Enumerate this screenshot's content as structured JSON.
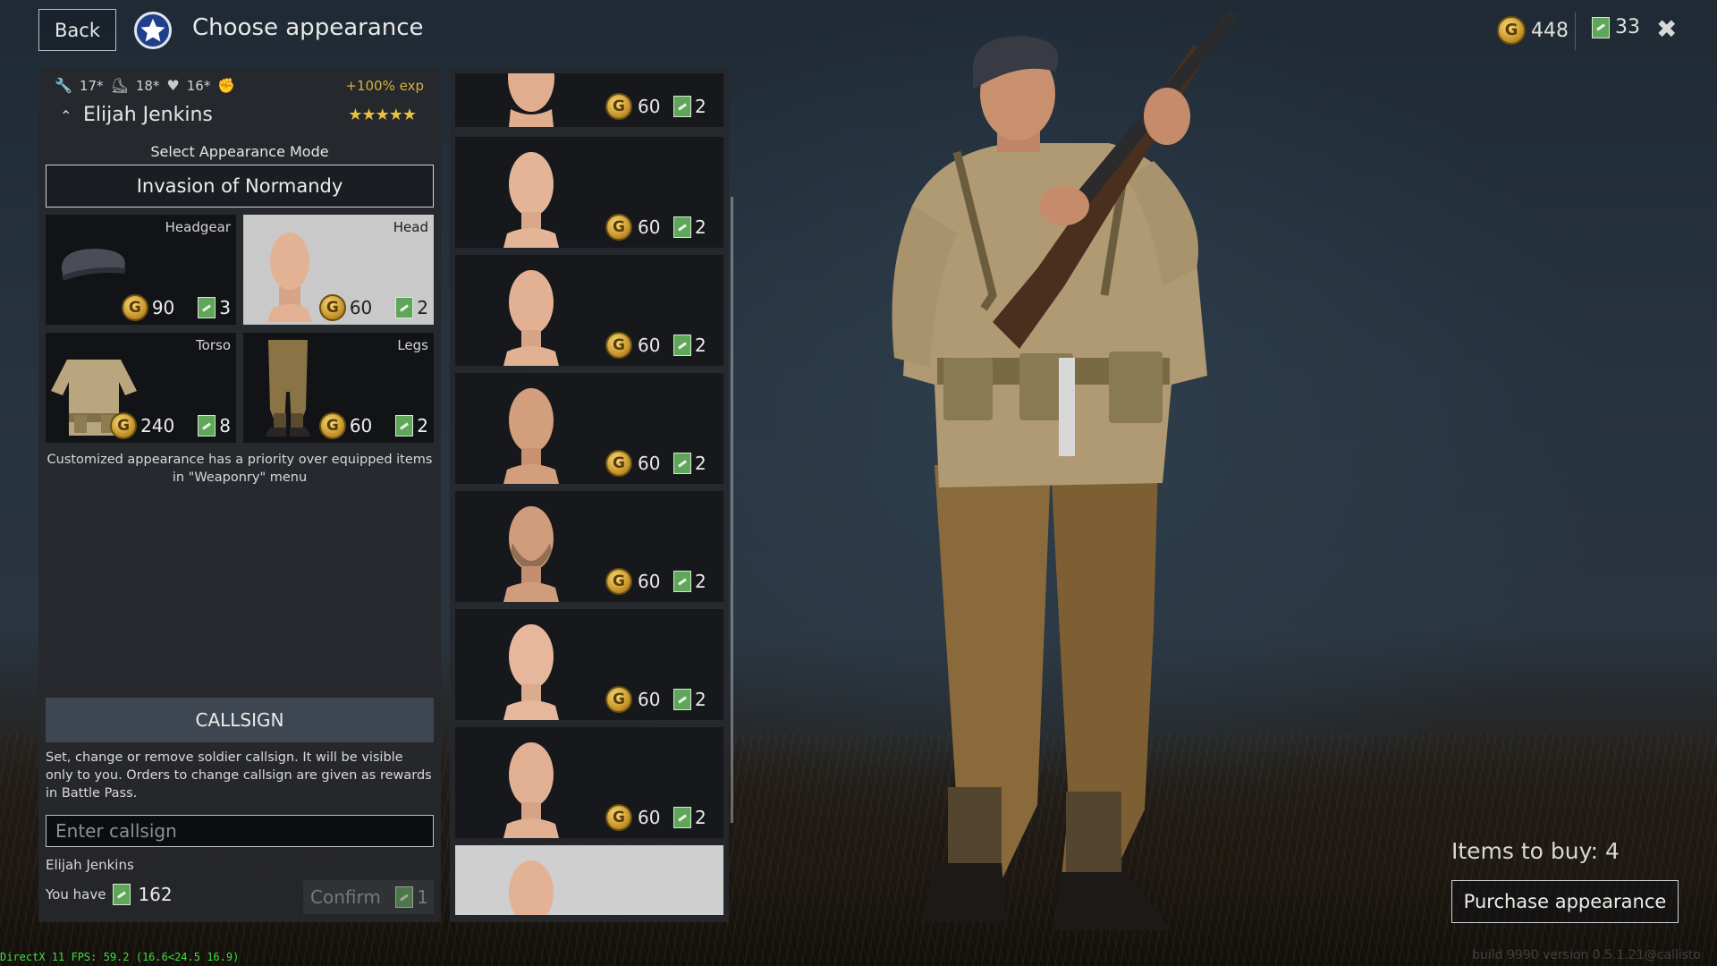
{
  "header": {
    "back_label": "Back",
    "title": "Choose appearance",
    "silver": "448",
    "orders": "33",
    "close": "✖"
  },
  "soldier": {
    "stats": [
      "17*",
      "18*",
      "16*"
    ],
    "exp_bonus": "+100% exp",
    "name": "Elijah Jenkins",
    "stars": "★★★★★"
  },
  "appearance": {
    "mode_label": "Select Appearance Mode",
    "mode_value": "Invasion of Normandy",
    "slots": [
      {
        "label": "Headgear",
        "silver": "90",
        "orders": "3",
        "icon": "beret-icon"
      },
      {
        "label": "Head",
        "silver": "60",
        "orders": "2",
        "icon": "head-icon"
      },
      {
        "label": "Torso",
        "silver": "240",
        "orders": "8",
        "icon": "jacket-icon"
      },
      {
        "label": "Legs",
        "silver": "60",
        "orders": "2",
        "icon": "trousers-icon"
      }
    ],
    "note": "Customized appearance has a priority over equipped items in \"Weaponry\" menu"
  },
  "callsign": {
    "title": "CALLSIGN",
    "description": "Set, change or remove soldier callsign. It will be visible only to you. Orders to change callsign are given as rewards in Battle Pass.",
    "placeholder": "Enter callsign",
    "current": "Elijah Jenkins",
    "you_have_label": "You have",
    "you_have_amount": "162",
    "confirm_label": "Confirm",
    "confirm_cost": "1"
  },
  "heads": [
    {
      "silver": "60",
      "orders": "2"
    },
    {
      "silver": "60",
      "orders": "2"
    },
    {
      "silver": "60",
      "orders": "2"
    },
    {
      "silver": "60",
      "orders": "2"
    },
    {
      "silver": "60",
      "orders": "2"
    },
    {
      "silver": "60",
      "orders": "2"
    },
    {
      "silver": "60",
      "orders": "2"
    }
  ],
  "footer": {
    "items_to_buy": "Items to buy: 4",
    "purchase_label": "Purchase appearance",
    "debug": "DirectX 11 FPS: 59.2 (16.6<24.5 16.9)",
    "build": "build 9990 version 0.5.1.21@callisto"
  },
  "colors": {
    "accent_gold": "#d4b23c",
    "selected_slot": "#c9c9c9",
    "order_green": "#5fa65a",
    "debug_green": "#39e23c"
  }
}
